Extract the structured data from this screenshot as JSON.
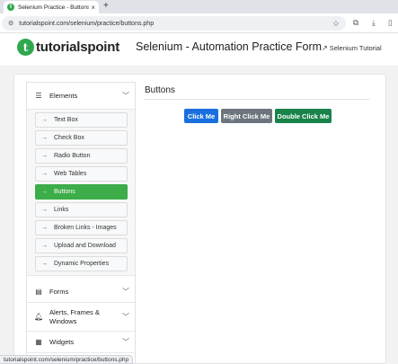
{
  "browser": {
    "tab_title": "Selenium Practice - Buttons",
    "url": "tutorialspoint.com/selenium/practice/buttons.php"
  },
  "header": {
    "logo_text": "tutorialspoint",
    "logo_mark": "t",
    "page_heading": "Selenium - Automation Practice Form",
    "tutorial_link": "Selenium Tutorial"
  },
  "sidebar": {
    "elements_label": "Elements",
    "items": [
      {
        "label": "Text Box"
      },
      {
        "label": "Check Box"
      },
      {
        "label": "Radio Button"
      },
      {
        "label": "Web Tables"
      },
      {
        "label": "Buttons",
        "active": true
      },
      {
        "label": "Links"
      },
      {
        "label": "Broken Links - Images"
      },
      {
        "label": "Upload and Download"
      },
      {
        "label": "Dynamic Properties"
      }
    ],
    "forms_label": "Forms",
    "alerts_label": "Alerts, Frames & Windows",
    "widgets_label": "Widgets"
  },
  "main": {
    "title": "Buttons",
    "buttons": {
      "click": "Click Me",
      "right_click": "Right Click Me",
      "double_click": "Double Click Me"
    }
  },
  "status_bar": "tutorialspoint.com/selenium/practice/buttons.php",
  "colors": {
    "brand_green": "#2fa84f",
    "active_item": "#3cad48",
    "primary_blue": "#1a6fe0",
    "secondary_gray": "#6c757d",
    "success_green": "#19834a"
  }
}
